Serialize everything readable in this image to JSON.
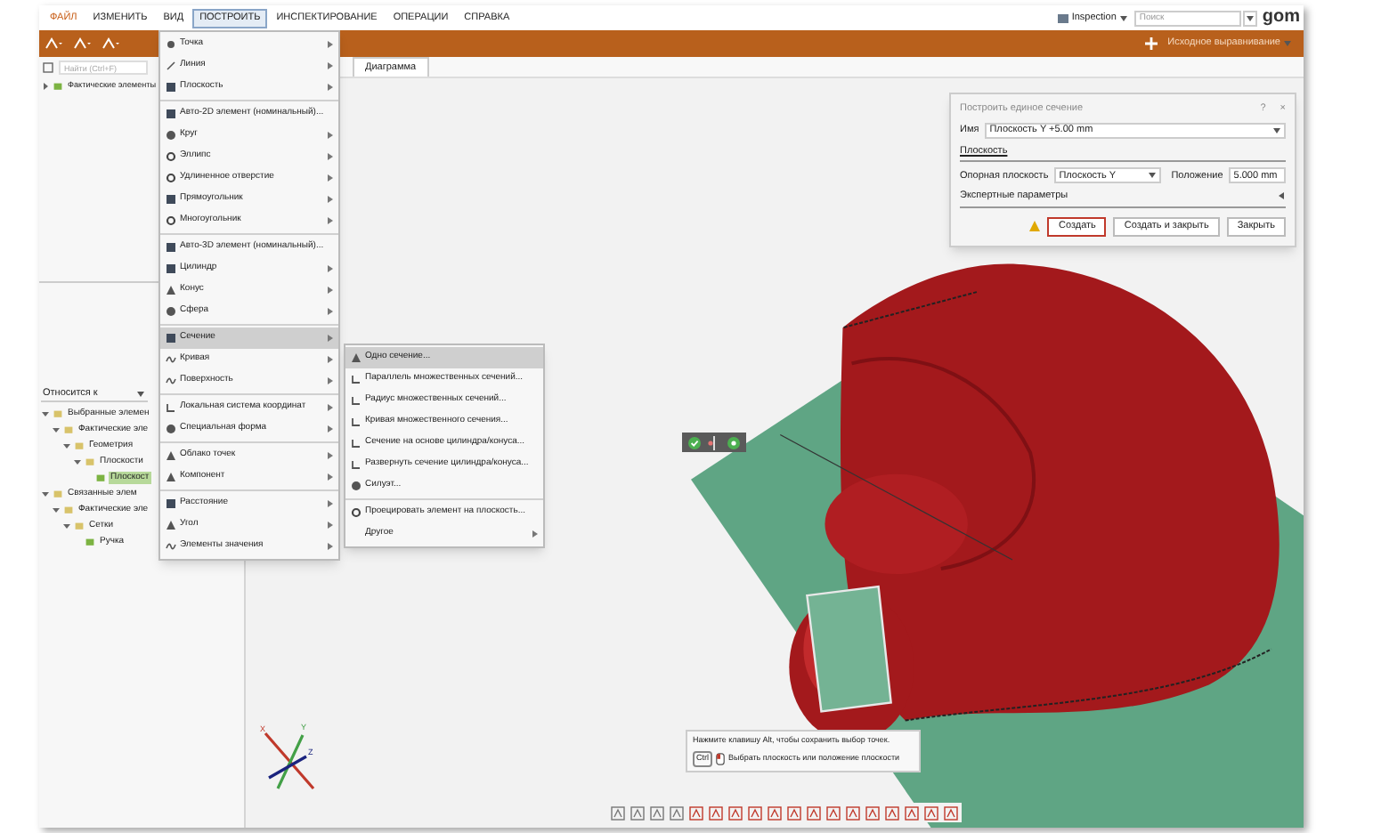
{
  "menubar": {
    "items": [
      {
        "label": "ФАЙЛ",
        "selected": false
      },
      {
        "label": "ИЗМЕНИТЬ",
        "selected": false
      },
      {
        "label": "ВИД",
        "selected": false
      },
      {
        "label": "ПОСТРОИТЬ",
        "selected": true
      },
      {
        "label": "ИНСПЕКТИРОВАНИЕ",
        "selected": false
      },
      {
        "label": "ОПЕРАЦИИ",
        "selected": false
      },
      {
        "label": "СПРАВКА",
        "selected": false
      }
    ]
  },
  "workspace": {
    "label": "Inspection"
  },
  "search": {
    "placeholder": "Поиск"
  },
  "logo": "gom",
  "toolbar": {
    "alignment": "Исходное выравнивание"
  },
  "explorer": {
    "search_placeholder": "Найти (Ctrl+F)",
    "tree": [
      {
        "label": "Фактические элементы",
        "expanded": false
      }
    ]
  },
  "view_tab": {
    "label": "Диаграмма"
  },
  "properties": {
    "filter": "Относится к",
    "tree": [
      {
        "label": "Выбранные элемен",
        "expanded": true,
        "selected": false,
        "children": [
          {
            "label": "Фактические эле",
            "expanded": true,
            "selected": false,
            "children": [
              {
                "label": "Геометрия",
                "expanded": true,
                "selected": false,
                "children": [
                  {
                    "label": "Плоскости",
                    "expanded": true,
                    "selected": false,
                    "children": [
                      {
                        "label": "Плоскост",
                        "selected": true
                      }
                    ]
                  }
                ]
              }
            ]
          }
        ]
      },
      {
        "label": "Связанные элем",
        "expanded": true,
        "selected": false,
        "children": [
          {
            "label": "Фактические эле",
            "expanded": true,
            "selected": false,
            "children": [
              {
                "label": "Сетки",
                "expanded": true,
                "selected": false,
                "children": [
                  {
                    "label": "Ручка",
                    "selected": false
                  }
                ]
              }
            ]
          }
        ]
      }
    ]
  },
  "menu": {
    "groups": [
      [
        {
          "label": "Точка",
          "submenu": true,
          "selected": false
        },
        {
          "label": "Линия",
          "submenu": true,
          "selected": false
        },
        {
          "label": "Плоскость",
          "submenu": true,
          "selected": false
        }
      ],
      [
        {
          "label": "Авто-2D элемент (номинальный)...",
          "submenu": false,
          "selected": false
        },
        {
          "label": "Круг",
          "submenu": true,
          "selected": false
        },
        {
          "label": "Эллипс",
          "submenu": true,
          "selected": false
        },
        {
          "label": "Удлиненное отверстие",
          "submenu": true,
          "selected": false
        },
        {
          "label": "Прямоугольник",
          "submenu": true,
          "selected": false
        },
        {
          "label": "Многоугольник",
          "submenu": true,
          "selected": false
        }
      ],
      [
        {
          "label": "Авто-3D элемент (номинальный)...",
          "submenu": false,
          "selected": false
        },
        {
          "label": "Цилиндр",
          "submenu": true,
          "selected": false
        },
        {
          "label": "Конус",
          "submenu": true,
          "selected": false
        },
        {
          "label": "Сфера",
          "submenu": true,
          "selected": false
        }
      ],
      [
        {
          "label": "Сечение",
          "submenu": true,
          "selected": true
        },
        {
          "label": "Кривая",
          "submenu": true,
          "selected": false
        },
        {
          "label": "Поверхность",
          "submenu": true,
          "selected": false
        }
      ],
      [
        {
          "label": "Локальная система координат",
          "submenu": true,
          "selected": false
        },
        {
          "label": "Специальная форма",
          "submenu": true,
          "selected": false
        }
      ],
      [
        {
          "label": "Облако точек",
          "submenu": true,
          "selected": false
        },
        {
          "label": "Компонент",
          "submenu": true,
          "selected": false
        }
      ],
      [
        {
          "label": "Расстояние",
          "submenu": true,
          "selected": false
        },
        {
          "label": "Угол",
          "submenu": true,
          "selected": false
        },
        {
          "label": "Элементы значения",
          "submenu": true,
          "selected": false
        }
      ]
    ]
  },
  "submenu": {
    "groups": [
      [
        {
          "label": "Одно сечение...",
          "submenu": false,
          "selected": true
        },
        {
          "label": "Параллель множественных сечений...",
          "submenu": false,
          "selected": false
        },
        {
          "label": "Радиус множественных сечений...",
          "submenu": false,
          "selected": false
        },
        {
          "label": "Кривая множественного сечения...",
          "submenu": false,
          "selected": false
        },
        {
          "label": "Сечение на основе цилиндра/конуса...",
          "submenu": false,
          "selected": false
        },
        {
          "label": "Развернуть сечение цилиндра/конуса...",
          "submenu": false,
          "selected": false
        },
        {
          "label": "Силуэт...",
          "submenu": false,
          "selected": false
        }
      ],
      [
        {
          "label": "Проецировать элемент на плоскость...",
          "submenu": false,
          "selected": false
        },
        {
          "label": "Другое",
          "submenu": true,
          "selected": false
        }
      ]
    ]
  },
  "dialog": {
    "title": "Построить единое сечение",
    "help": "?",
    "close": "×",
    "name_label": "Имя",
    "name_value": "Плоскость Y +5.00 mm",
    "section": "Плоскость",
    "ref_label": "Опорная плоскость",
    "ref_value": "Плоскость Y",
    "pos_label": "Положение",
    "pos_value": "5.000 mm",
    "expert": "Экспертные параметры",
    "expert_expanded": false,
    "buttons": [
      {
        "label": "Создать",
        "default": true
      },
      {
        "label": "Создать и закрыть",
        "default": false
      },
      {
        "label": "Закрыть",
        "default": false
      }
    ]
  },
  "hint": {
    "line1": "Нажмите клавишу Alt, чтобы сохранить выбор точек.",
    "key": "Ctrl",
    "line2": "Выбрать плоскость или положение плоскости"
  },
  "axes": [
    "X",
    "Y",
    "Z"
  ]
}
